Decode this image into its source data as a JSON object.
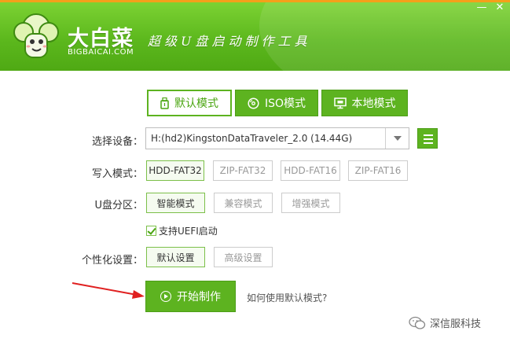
{
  "window": {
    "brand_name": "大白菜",
    "brand_site": "BIGBAICAI.COM",
    "slogan": "超级U盘启动制作工具",
    "minimize_glyph": "—",
    "close_glyph": "✕"
  },
  "tabs": [
    {
      "label": "默认模式",
      "icon": "usb-drive-icon",
      "active": true
    },
    {
      "label": "ISO模式",
      "icon": "disc-icon",
      "active": false
    },
    {
      "label": "本地模式",
      "icon": "monitor-icon",
      "active": false
    }
  ],
  "device": {
    "label": "选择设备：",
    "value": "H:(hd2)KingstonDataTraveler_2.0 (14.44G)"
  },
  "write_mode": {
    "label": "写入模式：",
    "options": [
      "HDD-FAT32",
      "ZIP-FAT32",
      "HDD-FAT16",
      "ZIP-FAT16"
    ],
    "selected": "HDD-FAT32"
  },
  "partition": {
    "label": "U盘分区：",
    "options": [
      "智能模式",
      "兼容模式",
      "增强模式"
    ],
    "selected": "智能模式"
  },
  "uefi": {
    "label": "支持UEFI启动",
    "checked": true
  },
  "personalize": {
    "label": "个性化设置：",
    "options": [
      "默认设置",
      "高级设置"
    ],
    "selected": "默认设置"
  },
  "actions": {
    "start_label": "开始制作",
    "help_link": "如何使用默认模式?"
  },
  "watermark": {
    "text": "深信服科技"
  },
  "colors": {
    "brand_green": "#5db320",
    "header_top": "#7cd233",
    "orange_strip": "#f4a01a",
    "annotation_red": "#e02020"
  }
}
